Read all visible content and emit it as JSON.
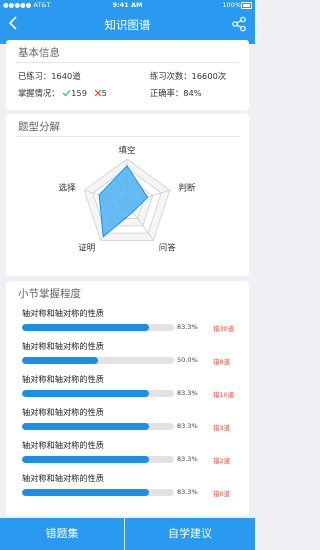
{
  "status": {
    "carrier": "●●●●● AT&T",
    "time": "9:41 AM",
    "battery": "100%"
  },
  "nav": {
    "title": "知识图谱",
    "back_icon": "chevron-left-icon",
    "share_icon": "share-icon"
  },
  "basic": {
    "title": "基本信息",
    "practiced_label": "已练习：",
    "practiced_value": "1640道",
    "count_label": "练习次数：",
    "count_value": "16600次",
    "mastery_label": "掌握情况：",
    "correct_count": "159",
    "wrong_count": "5",
    "accuracy_label": "正确率：",
    "accuracy_value": "84%"
  },
  "question_types": {
    "title": "题型分解",
    "axes": [
      "填空",
      "判断",
      "问答",
      "证明",
      "选择"
    ],
    "values": [
      0.85,
      0.48,
      0.22,
      0.9,
      0.65
    ]
  },
  "sections": {
    "title": "小节掌握程度",
    "items": [
      {
        "label": "轴对称和轴对称的性质",
        "percent": 83.3,
        "percent_text": "83.3%",
        "errors": "错30道"
      },
      {
        "label": "轴对称和轴对称的性质",
        "percent": 50.0,
        "percent_text": "50.0%",
        "errors": "错8道"
      },
      {
        "label": "轴对称和轴对称的性质",
        "percent": 83.3,
        "percent_text": "83.3%",
        "errors": "错10道"
      },
      {
        "label": "轴对称和轴对称的性质",
        "percent": 83.3,
        "percent_text": "83.3%",
        "errors": "错3道"
      },
      {
        "label": "轴对称和轴对称的性质",
        "percent": 83.3,
        "percent_text": "83.3%",
        "errors": "错2道"
      },
      {
        "label": "轴对称和轴对称的性质",
        "percent": 83.3,
        "percent_text": "83.3%",
        "errors": "错0道"
      }
    ]
  },
  "bottom": {
    "left_label": "错题集",
    "right_label": "自学建议"
  },
  "colors": {
    "accent": "#2a9af0",
    "fill": "#1b8fe6",
    "error": "#e64a3b",
    "correct": "#3ab26b"
  }
}
